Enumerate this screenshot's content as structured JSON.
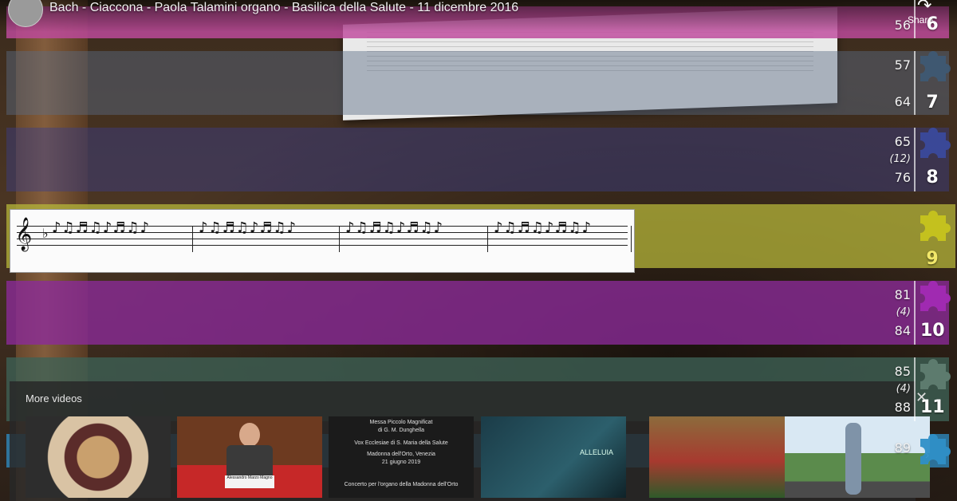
{
  "header": {
    "title": "Bach - Ciaccona - Paola Talamini organo - Basilica della Salute - 11 dicembre 2016",
    "share_label": "Share"
  },
  "colors": {
    "band_pink": "#c04a9e",
    "band_blue_top": "#5a6d86",
    "band_indigo": "#3a3e8a",
    "band_olive": "#b5b53a",
    "band_purple": "#8c2a9a",
    "band_teal": "#3e6256",
    "band_azure": "#2f8fc7"
  },
  "bands": [
    {
      "piece": "6",
      "start": "56",
      "end": null,
      "count": null,
      "icon": "puzzle-piece-icon"
    },
    {
      "piece": "7",
      "start": "57",
      "end": "64",
      "count": null,
      "icon": "puzzle-piece-icon"
    },
    {
      "piece": "8",
      "start": "65",
      "end": "76",
      "count": "(12)",
      "icon": "puzzle-piece-icon"
    },
    {
      "piece": "9",
      "start": null,
      "end": null,
      "count": null,
      "icon": "puzzle-piece-icon"
    },
    {
      "piece": "10",
      "start": "81",
      "end": "84",
      "count": "(4)",
      "icon": "puzzle-piece-icon"
    },
    {
      "piece": "11",
      "start": "85",
      "end": "88",
      "count": "(4)",
      "icon": "puzzle-piece-icon"
    },
    {
      "piece": null,
      "start": "89",
      "end": null,
      "count": null,
      "icon": "puzzle-piece-icon"
    }
  ],
  "more_videos": {
    "label": "More videos",
    "close_icon": "close-icon",
    "next_icon": "chevron-right-icon",
    "thumbs": [
      {
        "name": "thumb-icon-madonna"
      },
      {
        "name": "thumb-speaker",
        "caption": "Alessandro Marzo Magno"
      },
      {
        "name": "thumb-concert-text",
        "lines": [
          "Messa Piccolo Magnificat",
          "di G. M. Dunghella",
          "Vox Ecclesiae di S. Maria della Salute",
          "Madonna dell'Orto, Venezia",
          "21 giugno 2019",
          "Concerto per l'organo della Madonna dell'Orto"
        ]
      },
      {
        "name": "thumb-organist",
        "caption": "ALLELUIA"
      },
      {
        "name": "thumb-painting"
      },
      {
        "name": "thumb-road"
      }
    ]
  }
}
